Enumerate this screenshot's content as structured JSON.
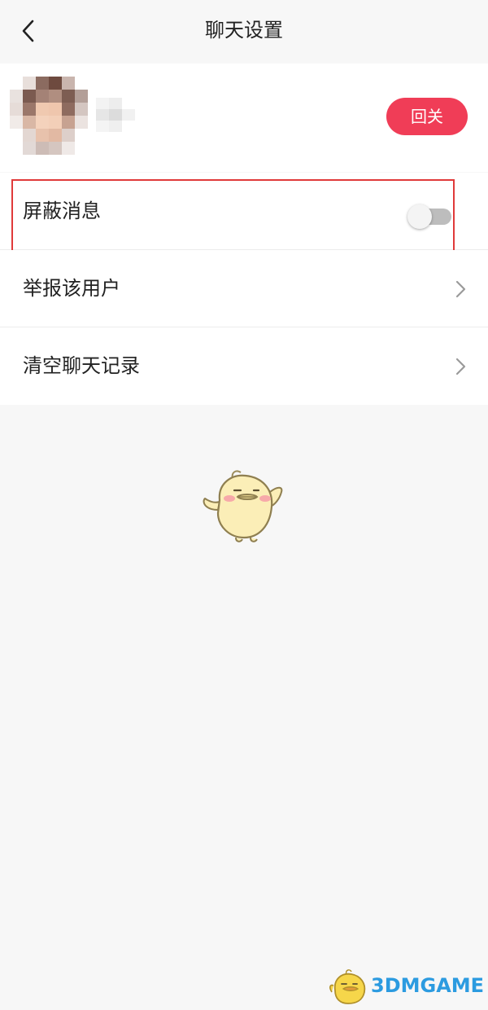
{
  "header": {
    "title": "聊天设置",
    "back_icon": "back-arrow-icon"
  },
  "profile": {
    "avatar": "blurred-avatar",
    "follow_label": "回关",
    "follow_color": "#f03d57"
  },
  "settings": {
    "items": [
      {
        "label": "屏蔽消息",
        "control": "toggle",
        "checked": false
      },
      {
        "label": "举报该用户",
        "control": "chevron"
      },
      {
        "label": "清空聊天记录",
        "control": "chevron"
      }
    ]
  },
  "highlight_color": "#e03a3a",
  "watermark": {
    "text": "3DMGAME",
    "color": "#2c9be0"
  }
}
